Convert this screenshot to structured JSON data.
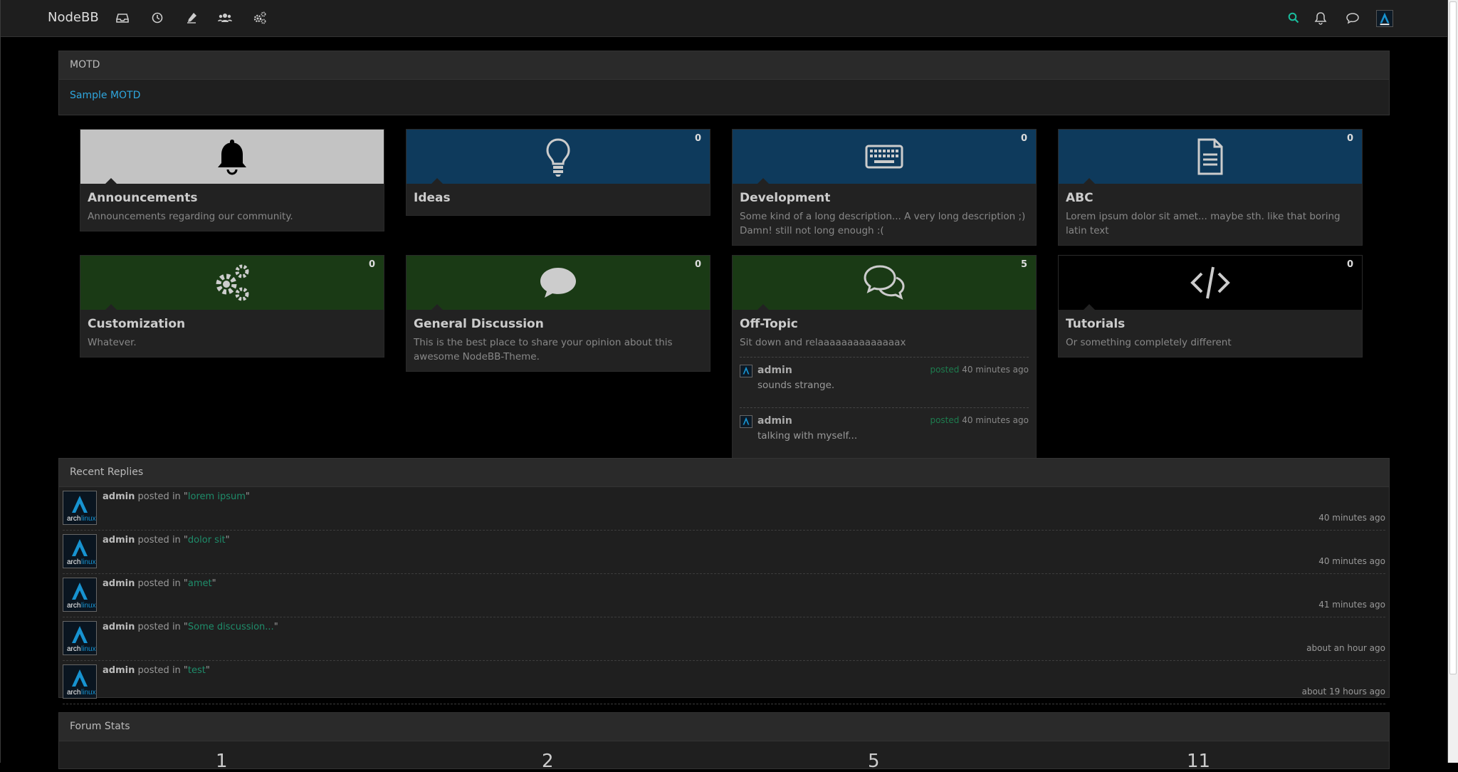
{
  "navbar": {
    "brand": "NodeBB",
    "nav_icons": [
      "inbox-icon",
      "clock-icon",
      "pen-icon",
      "users-icon",
      "cogs-icon"
    ],
    "right_icons": [
      "search-icon",
      "bell-icon",
      "chat-icon"
    ]
  },
  "motd": {
    "heading": "MOTD",
    "text": "Sample MOTD"
  },
  "categories": [
    {
      "title": "Announcements",
      "desc": "Announcements regarding our community.",
      "count": "",
      "icon": "bell-icon",
      "bg": "#c3c3c3",
      "icon_color": "#000"
    },
    {
      "title": "Ideas",
      "desc": "",
      "count": "0",
      "icon": "lightbulb-icon",
      "bg": "#0e3a5c",
      "icon_color": "#ccc"
    },
    {
      "title": "Development",
      "desc": "Some kind of a long description... A very long description ;) Damn! still not long enough :(",
      "count": "0",
      "icon": "keyboard-icon",
      "bg": "#0e3a5c",
      "icon_color": "#ccc"
    },
    {
      "title": "ABC",
      "desc": "Lorem ipsum dolor sit amet... maybe sth. like that boring latin text",
      "count": "0",
      "icon": "document-icon",
      "bg": "#0e3a5c",
      "icon_color": "#ccc"
    },
    {
      "title": "Customization",
      "desc": "Whatever.",
      "count": "0",
      "icon": "cogs-icon",
      "bg": "#1a3a15",
      "icon_color": "#ccc"
    },
    {
      "title": "General Discussion",
      "desc": "This is the best place to share your opinion about this awesome NodeBB-Theme.",
      "count": "0",
      "icon": "comment-icon",
      "bg": "#1a3a15",
      "icon_color": "#ccc"
    },
    {
      "title": "Off-Topic",
      "desc": "Sit down and relaaaaaaaaaaaaaax",
      "count": "5",
      "icon": "comments-icon",
      "bg": "#1a3a15",
      "icon_color": "#ccc"
    },
    {
      "title": "Tutorials",
      "desc": "Or something completely different",
      "count": "0",
      "icon": "code-icon",
      "bg": "#000000",
      "icon_color": "#ccc"
    }
  ],
  "offtopic_replies": [
    {
      "user": "admin",
      "text": "sounds strange.",
      "posted": "posted",
      "time": "40 minutes ago"
    },
    {
      "user": "admin",
      "text": "talking with myself...",
      "posted": "posted",
      "time": "40 minutes ago"
    }
  ],
  "recent_replies": {
    "heading": "Recent Replies",
    "posted_in": "posted in",
    "items": [
      {
        "user": "admin",
        "topic": "lorem ipsum",
        "time": "40 minutes ago"
      },
      {
        "user": "admin",
        "topic": "dolor sit",
        "time": "40 minutes ago"
      },
      {
        "user": "admin",
        "topic": "amet",
        "time": "41 minutes ago"
      },
      {
        "user": "admin",
        "topic": "Some discussion...",
        "time": "about an hour ago"
      },
      {
        "user": "admin",
        "topic": "test",
        "time": "about 19 hours ago"
      }
    ]
  },
  "forum_stats": {
    "heading": "Forum Stats",
    "values": [
      "1",
      "2",
      "5",
      "11"
    ]
  },
  "colors": {
    "link": "#2fa6dd",
    "accent_green": "#1f8c6a",
    "search": "#1abc9c"
  }
}
